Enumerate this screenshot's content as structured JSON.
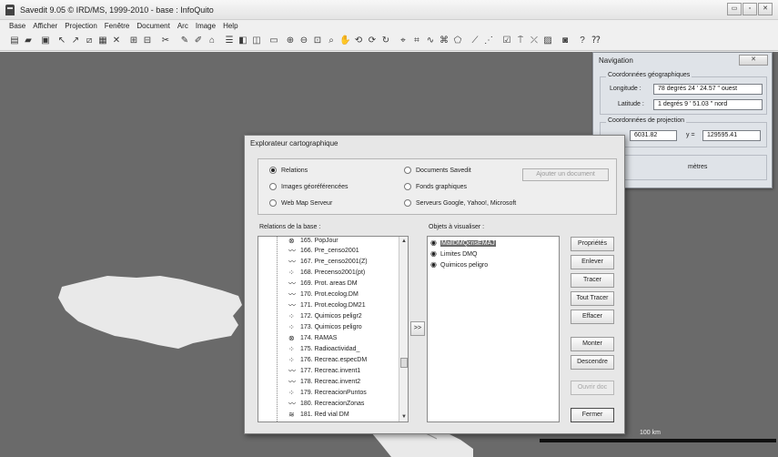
{
  "window": {
    "title": "Savedit 9.05 © IRD/MS, 1999-2010  -  base : InfoQuito",
    "controls": [
      "▭",
      "▫",
      "✕"
    ]
  },
  "menubar": [
    "Base",
    "Afficher",
    "Projection",
    "Fenêtre",
    "Document",
    "Arc",
    "Image",
    "Help"
  ],
  "map": {
    "scale_label": "100 km"
  },
  "navigation": {
    "title": "Navigation",
    "close": "✕",
    "geo_group": "Coordonnées géographiques",
    "longitude_label": "Longitude :",
    "longitude_value": "78 degrés 24 ' 24.57 \"  ouest",
    "latitude_label": "Latitude :",
    "latitude_value": "1 degrés  9 ' 51.03 \"  nord",
    "proj_group": "Coordonnées de projection",
    "x_value": "6031.82",
    "y_label": "y =",
    "y_value": "129595.41",
    "third_group_fragment": "e",
    "meters_label": "mètres"
  },
  "explorer": {
    "title": "Explorateur cartographique",
    "radios": [
      {
        "label": "Relations",
        "selected": true
      },
      {
        "label": "Images géoréférencées",
        "selected": false
      },
      {
        "label": "Web Map Serveur",
        "selected": false
      },
      {
        "label": "Documents Savedit",
        "selected": false
      },
      {
        "label": "Fonds graphiques",
        "selected": false
      },
      {
        "label": "Serveurs Google, Yahoo!, Microsoft",
        "selected": false
      }
    ],
    "add_document": "Ajouter un document",
    "relations_label": "Relations de la base :",
    "objects_label": "Objets à visualiser :",
    "transfer": ">>",
    "relations": [
      {
        "label": "165. PopJour",
        "icon": "circle"
      },
      {
        "label": "166. Pre_censo2001",
        "icon": "line"
      },
      {
        "label": "167. Pre_censo2001(Z)",
        "icon": "line"
      },
      {
        "label": "168. Precenso2001(pt)",
        "icon": "dots"
      },
      {
        "label": "169. Prot. areas DM",
        "icon": "line"
      },
      {
        "label": "170. Prot.ecolog.DM",
        "icon": "line"
      },
      {
        "label": "171. Prot.ecolog.DM21",
        "icon": "line"
      },
      {
        "label": "172. Quimicos peligr2",
        "icon": "dots"
      },
      {
        "label": "173. Quimicos peligro",
        "icon": "dots"
      },
      {
        "label": "174. RAMAS",
        "icon": "circle"
      },
      {
        "label": "175. Radioactividad_",
        "icon": "dots"
      },
      {
        "label": "176. Recreac.especDM",
        "icon": "dots"
      },
      {
        "label": "177. Recreac.invent1",
        "icon": "line"
      },
      {
        "label": "178. Recreac.invent2",
        "icon": "line"
      },
      {
        "label": "179. RecreacionPuntos",
        "icon": "dots"
      },
      {
        "label": "180. RecreacionZonas",
        "icon": "line"
      },
      {
        "label": "181. Red vial DM",
        "icon": "wave"
      }
    ],
    "objects": [
      {
        "label": "MallDMQcrisEMAJ",
        "selected": true
      },
      {
        "label": "Limites DMQ",
        "selected": false
      },
      {
        "label": "Quimicos peligro",
        "selected": false
      }
    ],
    "buttons": {
      "proprietes": "Propriétés",
      "enlever": "Enlever",
      "tracer": "Tracer",
      "tout_tracer": "Tout Tracer",
      "effacer": "Effacer",
      "monter": "Monter",
      "descendre": "Descendre",
      "ouvrir_doc": "Ouvrir doc",
      "fermer": "Fermer"
    }
  }
}
